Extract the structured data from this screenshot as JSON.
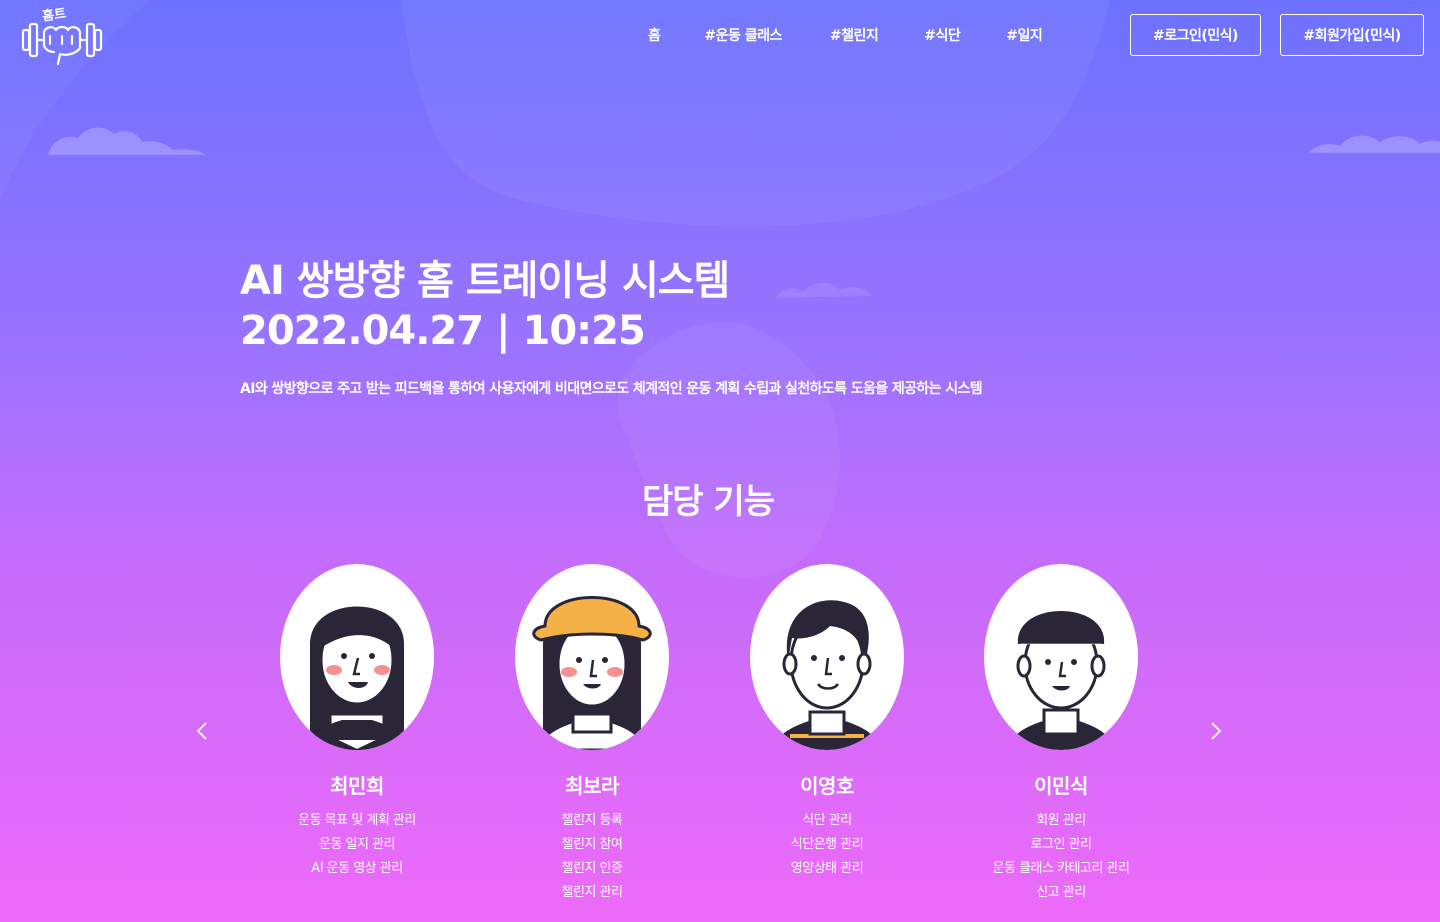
{
  "nav": {
    "logo_text": "홈트",
    "links": [
      {
        "label": "홈"
      },
      {
        "label": "#운동 클래스"
      },
      {
        "label": "#챌린지"
      },
      {
        "label": "#식단"
      },
      {
        "label": "#일지"
      }
    ],
    "login_label": "#로그인(민식)",
    "signup_label": "#회원가입(민식)"
  },
  "hero": {
    "title": "AI 쌍방향 홈 트레이닝 시스템",
    "date": "2022.04.27 | 10:25",
    "description": "AI와 쌍방향으로 주고 받는 피드백을 통하여 사용자에게 비대면으로도 체계적인 운동 계획 수립과 실천하도록 도움을 제공하는 시스템"
  },
  "section": {
    "title": "담당 기능"
  },
  "members": [
    {
      "name": "최민희",
      "duties": [
        "운동 목표 및 계획 관리",
        "운동 일지 관리",
        "AI 운동 영상 관리"
      ]
    },
    {
      "name": "최보라",
      "duties": [
        "챌린지 등록",
        "챌린지 참여",
        "챌린지 인증",
        "챌린지 관리"
      ]
    },
    {
      "name": "이영호",
      "duties": [
        "식단 관리",
        "식단은행 관리",
        "영양상태 관리"
      ]
    },
    {
      "name": "이민식",
      "duties": [
        "회원 관리",
        "로그인 관리",
        "운동 클래스 카테고리 관리",
        "신고 관리"
      ]
    }
  ],
  "icons": {
    "prev": "chevron-left-icon",
    "next": "chevron-right-icon",
    "logo": "dumbbell-logo-icon"
  },
  "colors": {
    "gradient_top": "#6c72ff",
    "gradient_bottom": "#ee6af9",
    "avatar_dark": "#2a2638",
    "cheek": "#f79191",
    "hat": "#f4b145"
  }
}
